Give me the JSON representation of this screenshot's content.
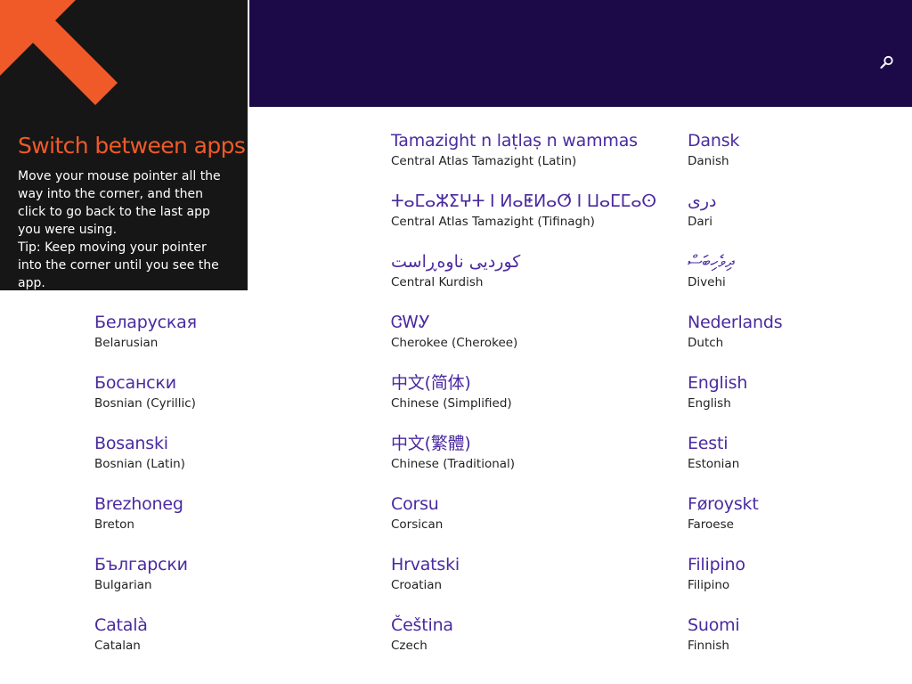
{
  "tip": {
    "title": "Switch between apps",
    "body": "Move your mouse pointer all the way into the corner, and then click to go back to the last app you were using.",
    "tip": "Tip: Keep moving your pointer into the corner until you see the app."
  },
  "header": {
    "search_icon": "search-icon"
  },
  "colors": {
    "header_bg": "#1c0a48",
    "tip_bg": "#161616",
    "accent": "#f05a28",
    "language_name": "#4a2aa0"
  },
  "languages": {
    "col1": [
      {
        "native": "Беларуская",
        "english": "Belarusian"
      },
      {
        "native": "Босански",
        "english": "Bosnian (Cyrillic)"
      },
      {
        "native": "Bosanski",
        "english": "Bosnian (Latin)"
      },
      {
        "native": "Brezhoneg",
        "english": "Breton"
      },
      {
        "native": "Български",
        "english": "Bulgarian"
      },
      {
        "native": "Català",
        "english": "Catalan"
      }
    ],
    "col2": [
      {
        "native": "Tamazight n laṭlaṣ n wammas",
        "english": "Central Atlas Tamazight (Latin)"
      },
      {
        "native": "ⵜⴰⵎⴰⵣⵉⵖⵜ ⵏ ⵍⴰⵟⵍⴰⵚ ⵏ ⵡⴰⵎⵎⴰⵙ",
        "english": "Central Atlas Tamazight (Tifinagh)"
      },
      {
        "native": "کوردیی ناوەڕاست",
        "english": "Central Kurdish"
      },
      {
        "native": "ᏣᎳᎩ",
        "english": "Cherokee (Cherokee)"
      },
      {
        "native": "中文(简体)",
        "english": "Chinese (Simplified)"
      },
      {
        "native": "中文(繁體)",
        "english": "Chinese (Traditional)"
      },
      {
        "native": "Corsu",
        "english": "Corsican"
      },
      {
        "native": "Hrvatski",
        "english": "Croatian"
      },
      {
        "native": "Čeština",
        "english": "Czech"
      }
    ],
    "col3": [
      {
        "native": "Dansk",
        "english": "Danish"
      },
      {
        "native": "دری",
        "english": "Dari"
      },
      {
        "native": "ދިވެހިބަސް",
        "english": "Divehi"
      },
      {
        "native": "Nederlands",
        "english": "Dutch"
      },
      {
        "native": "English",
        "english": "English"
      },
      {
        "native": "Eesti",
        "english": "Estonian"
      },
      {
        "native": "Føroyskt",
        "english": "Faroese"
      },
      {
        "native": "Filipino",
        "english": "Filipino"
      },
      {
        "native": "Suomi",
        "english": "Finnish"
      }
    ]
  }
}
